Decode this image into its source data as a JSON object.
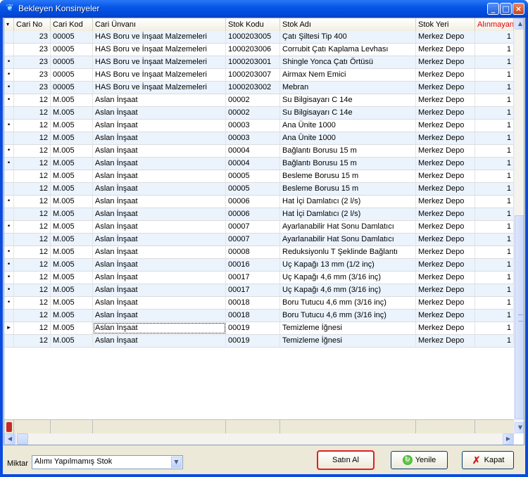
{
  "window": {
    "title": "Bekleyen Konsinyeler"
  },
  "columns": [
    "Cari No",
    "Cari Kod",
    "Cari Ünvanı",
    "Stok Kodu",
    "Stok Adı",
    "Stok Yeri",
    "Alınmayan"
  ],
  "rows": [
    {
      "indicator": "",
      "cari_no": "23",
      "cari_kod": "00005",
      "cari_unvani": "HAS Boru ve İnşaat Malzemeleri",
      "stok_kodu": "1000203005",
      "stok_adi": "Çatı Şiltesi Tip 400",
      "stok_yeri": "Merkez Depo",
      "alinmayan": "1"
    },
    {
      "indicator": "",
      "cari_no": "23",
      "cari_kod": "00005",
      "cari_unvani": "HAS Boru ve İnşaat Malzemeleri",
      "stok_kodu": "1000203006",
      "stok_adi": "Corrubit Çatı Kaplama Levhası",
      "stok_yeri": "Merkez Depo",
      "alinmayan": "1"
    },
    {
      "indicator": "•",
      "cari_no": "23",
      "cari_kod": "00005",
      "cari_unvani": "HAS Boru ve İnşaat Malzemeleri",
      "stok_kodu": "1000203001",
      "stok_adi": "Shingle Yonca Çatı Örtüsü",
      "stok_yeri": "Merkez Depo",
      "alinmayan": "1"
    },
    {
      "indicator": "•",
      "cari_no": "23",
      "cari_kod": "00005",
      "cari_unvani": "HAS Boru ve İnşaat Malzemeleri",
      "stok_kodu": "1000203007",
      "stok_adi": "Airmax Nem Emici",
      "stok_yeri": "Merkez Depo",
      "alinmayan": "1"
    },
    {
      "indicator": "•",
      "cari_no": "23",
      "cari_kod": "00005",
      "cari_unvani": "HAS Boru ve İnşaat Malzemeleri",
      "stok_kodu": "1000203002",
      "stok_adi": "Mebran",
      "stok_yeri": "Merkez Depo",
      "alinmayan": "1"
    },
    {
      "indicator": "•",
      "cari_no": "12",
      "cari_kod": "M.005",
      "cari_unvani": "Aslan İnşaat",
      "stok_kodu": "00002",
      "stok_adi": "Su Bilgisayarı C 14e",
      "stok_yeri": "Merkez Depo",
      "alinmayan": "1"
    },
    {
      "indicator": "",
      "cari_no": "12",
      "cari_kod": "M.005",
      "cari_unvani": "Aslan İnşaat",
      "stok_kodu": "00002",
      "stok_adi": "Su Bilgisayarı C 14e",
      "stok_yeri": "Merkez Depo",
      "alinmayan": "1"
    },
    {
      "indicator": "•",
      "cari_no": "12",
      "cari_kod": "M.005",
      "cari_unvani": "Aslan İnşaat",
      "stok_kodu": "00003",
      "stok_adi": "Ana Ünite 1000",
      "stok_yeri": "Merkez Depo",
      "alinmayan": "1"
    },
    {
      "indicator": "",
      "cari_no": "12",
      "cari_kod": "M.005",
      "cari_unvani": "Aslan İnşaat",
      "stok_kodu": "00003",
      "stok_adi": "Ana Ünite 1000",
      "stok_yeri": "Merkez Depo",
      "alinmayan": "1"
    },
    {
      "indicator": "•",
      "cari_no": "12",
      "cari_kod": "M.005",
      "cari_unvani": "Aslan İnşaat",
      "stok_kodu": "00004",
      "stok_adi": "Bağlantı Borusu 15 m",
      "stok_yeri": "Merkez Depo",
      "alinmayan": "1"
    },
    {
      "indicator": "•",
      "cari_no": "12",
      "cari_kod": "M.005",
      "cari_unvani": "Aslan İnşaat",
      "stok_kodu": "00004",
      "stok_adi": "Bağlantı Borusu 15 m",
      "stok_yeri": "Merkez Depo",
      "alinmayan": "1"
    },
    {
      "indicator": "",
      "cari_no": "12",
      "cari_kod": "M.005",
      "cari_unvani": "Aslan İnşaat",
      "stok_kodu": "00005",
      "stok_adi": "Besleme Borusu 15 m",
      "stok_yeri": "Merkez Depo",
      "alinmayan": "1"
    },
    {
      "indicator": "",
      "cari_no": "12",
      "cari_kod": "M.005",
      "cari_unvani": "Aslan İnşaat",
      "stok_kodu": "00005",
      "stok_adi": "Besleme Borusu 15 m",
      "stok_yeri": "Merkez Depo",
      "alinmayan": "1"
    },
    {
      "indicator": "•",
      "cari_no": "12",
      "cari_kod": "M.005",
      "cari_unvani": "Aslan İnşaat",
      "stok_kodu": "00006",
      "stok_adi": "Hat İçi Damlatıcı (2 l/s)",
      "stok_yeri": "Merkez Depo",
      "alinmayan": "1"
    },
    {
      "indicator": "",
      "cari_no": "12",
      "cari_kod": "M.005",
      "cari_unvani": "Aslan İnşaat",
      "stok_kodu": "00006",
      "stok_adi": "Hat İçi Damlatıcı (2 l/s)",
      "stok_yeri": "Merkez Depo",
      "alinmayan": "1"
    },
    {
      "indicator": "•",
      "cari_no": "12",
      "cari_kod": "M.005",
      "cari_unvani": "Aslan İnşaat",
      "stok_kodu": "00007",
      "stok_adi": "Ayarlanabilir Hat Sonu Damlatıcı",
      "stok_yeri": "Merkez Depo",
      "alinmayan": "1"
    },
    {
      "indicator": "",
      "cari_no": "12",
      "cari_kod": "M.005",
      "cari_unvani": "Aslan İnşaat",
      "stok_kodu": "00007",
      "stok_adi": "Ayarlanabilir Hat Sonu Damlatıcı",
      "stok_yeri": "Merkez Depo",
      "alinmayan": "1"
    },
    {
      "indicator": "•",
      "cari_no": "12",
      "cari_kod": "M.005",
      "cari_unvani": "Aslan İnşaat",
      "stok_kodu": "00008",
      "stok_adi": "Reduksiyonlu T Şeklinde Bağlantı",
      "stok_yeri": "Merkez Depo",
      "alinmayan": "1"
    },
    {
      "indicator": "•",
      "cari_no": "12",
      "cari_kod": "M.005",
      "cari_unvani": "Aslan İnşaat",
      "stok_kodu": "00016",
      "stok_adi": "Uç Kapağı 13 mm (1/2 inç)",
      "stok_yeri": "Merkez Depo",
      "alinmayan": "1"
    },
    {
      "indicator": "•",
      "cari_no": "12",
      "cari_kod": "M.005",
      "cari_unvani": "Aslan İnşaat",
      "stok_kodu": "00017",
      "stok_adi": "Uç Kapağı 4,6 mm (3/16 inç)",
      "stok_yeri": "Merkez Depo",
      "alinmayan": "1"
    },
    {
      "indicator": "•",
      "cari_no": "12",
      "cari_kod": "M.005",
      "cari_unvani": "Aslan İnşaat",
      "stok_kodu": "00017",
      "stok_adi": "Uç Kapağı 4,6 mm (3/16 inç)",
      "stok_yeri": "Merkez Depo",
      "alinmayan": "1"
    },
    {
      "indicator": "•",
      "cari_no": "12",
      "cari_kod": "M.005",
      "cari_unvani": "Aslan İnşaat",
      "stok_kodu": "00018",
      "stok_adi": "Boru Tutucu 4,6 mm (3/16 inç)",
      "stok_yeri": "Merkez Depo",
      "alinmayan": "1"
    },
    {
      "indicator": "",
      "cari_no": "12",
      "cari_kod": "M.005",
      "cari_unvani": "Aslan İnşaat",
      "stok_kodu": "00018",
      "stok_adi": "Boru Tutucu 4,6 mm (3/16 inç)",
      "stok_yeri": "Merkez Depo",
      "alinmayan": "1"
    },
    {
      "indicator": "▸",
      "cari_no": "12",
      "cari_kod": "M.005",
      "cari_unvani": "Aslan İnşaat",
      "stok_kodu": "00019",
      "stok_adi": "Temizleme İğnesi",
      "stok_yeri": "Merkez Depo",
      "alinmayan": "1"
    },
    {
      "indicator": "",
      "cari_no": "12",
      "cari_kod": "M.005",
      "cari_unvani": "Aslan İnşaat",
      "stok_kodu": "00019",
      "stok_adi": "Temizleme İğnesi",
      "stok_yeri": "Merkez Depo",
      "alinmayan": "1"
    }
  ],
  "miktar": {
    "label": "Miktar",
    "selected": "Alımı Yapılmamış Stok"
  },
  "buttons": {
    "satin_al": "Satın Al",
    "yenile": "Yenile",
    "kapat": "Kapat"
  },
  "colors": {
    "alinmayan_header": "#e00000",
    "highlight_button_border": "#e21f1f"
  }
}
